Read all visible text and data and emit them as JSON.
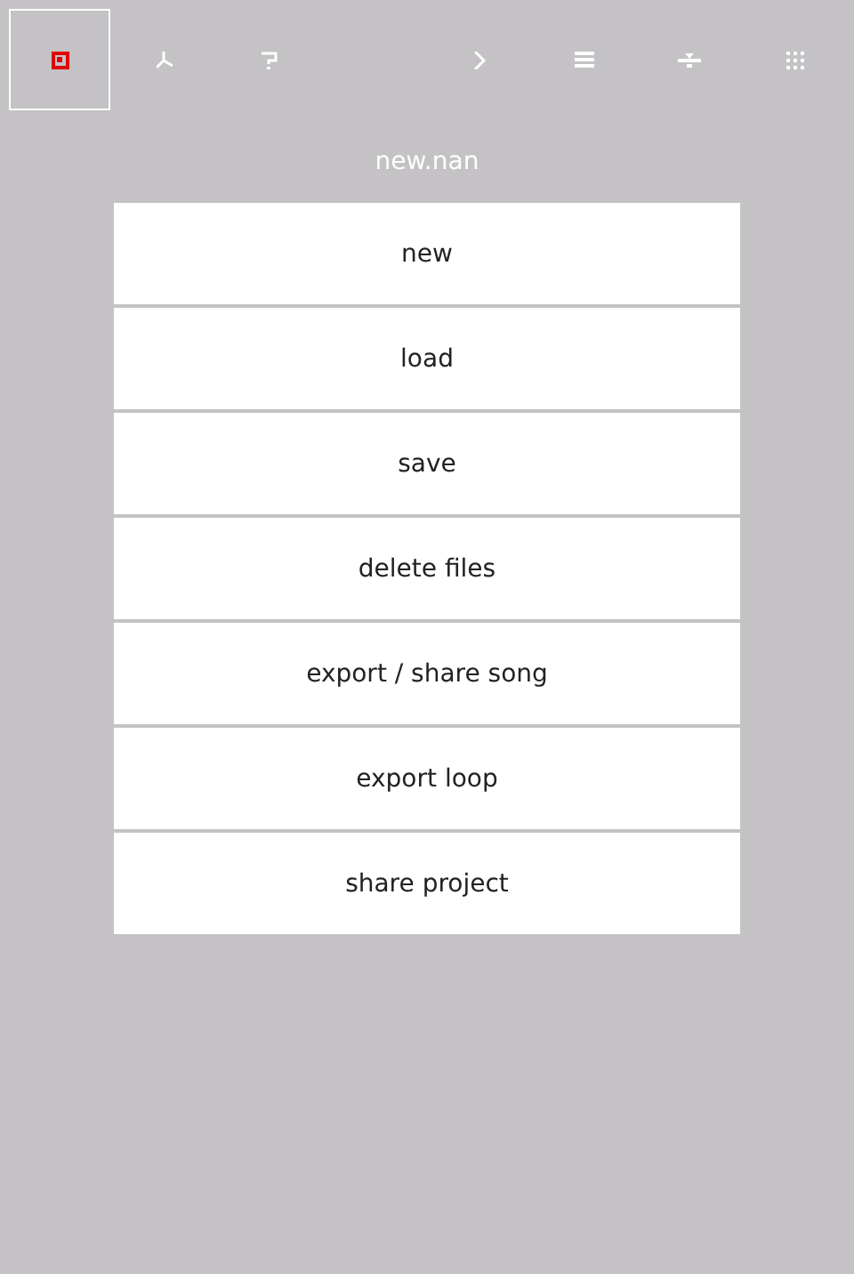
{
  "toolbar": [
    {
      "kind": "file",
      "selected": true
    },
    {
      "kind": "tools",
      "selected": false
    },
    {
      "kind": "help",
      "selected": false
    },
    {
      "kind": "play",
      "selected": false
    },
    {
      "kind": "list",
      "selected": false
    },
    {
      "kind": "mixer",
      "selected": false
    },
    {
      "kind": "grid",
      "selected": false
    }
  ],
  "title": "new.nan",
  "menu": [
    "new",
    "load",
    "save",
    "delete files",
    "export / share song",
    "export loop",
    "share project"
  ]
}
